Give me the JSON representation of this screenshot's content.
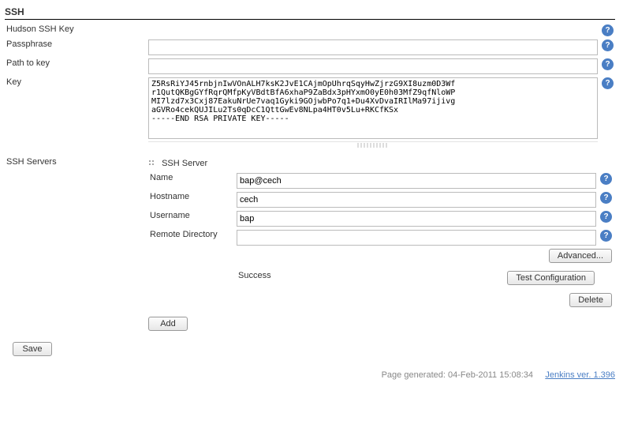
{
  "section": {
    "title": "SSH"
  },
  "fields": {
    "sshkey_label": "Hudson SSH Key",
    "passphrase_label": "Passphrase",
    "passphrase_value": "",
    "path_label": "Path to key",
    "path_value": "",
    "key_label": "Key",
    "key_value": "Z5RsRiYJ45rnbjnIwVOnALH7ksK2JvE1CAjmOpUhrqSqyHwZjrzG9XI8uzm0D3Wf\nr1QutQKBgGYfRqrQMfpKyVBdtBfA6xhaP9ZaBdx3pHYxmO0yE0h03MfZ9qfNloWP\nMI7lzd7x3Cxj87EakuNrUe7vaq1Gyki9GOjwbPo7q1+Du4XvDvaIRIlMa97ijivg\naGVRo4cekQUJILu2Ts0qDcC1QttGwEv8NLpa4HT0v5Lu+RKCfKSx\n-----END RSA PRIVATE KEY-----",
    "servers_label": "SSH Servers"
  },
  "server": {
    "header": "SSH Server",
    "name_label": "Name",
    "name_value": "bap@cech",
    "hostname_label": "Hostname",
    "hostname_value": "cech",
    "username_label": "Username",
    "username_value": "bap",
    "remotedir_label": "Remote Directory",
    "remotedir_value": "",
    "status": "Success"
  },
  "buttons": {
    "advanced": "Advanced...",
    "test": "Test Configuration",
    "delete": "Delete",
    "add": "Add",
    "save": "Save"
  },
  "footer": {
    "generated": "Page generated: 04-Feb-2011 15:08:34",
    "version": "Jenkins ver. 1.396"
  },
  "help_char": "?"
}
